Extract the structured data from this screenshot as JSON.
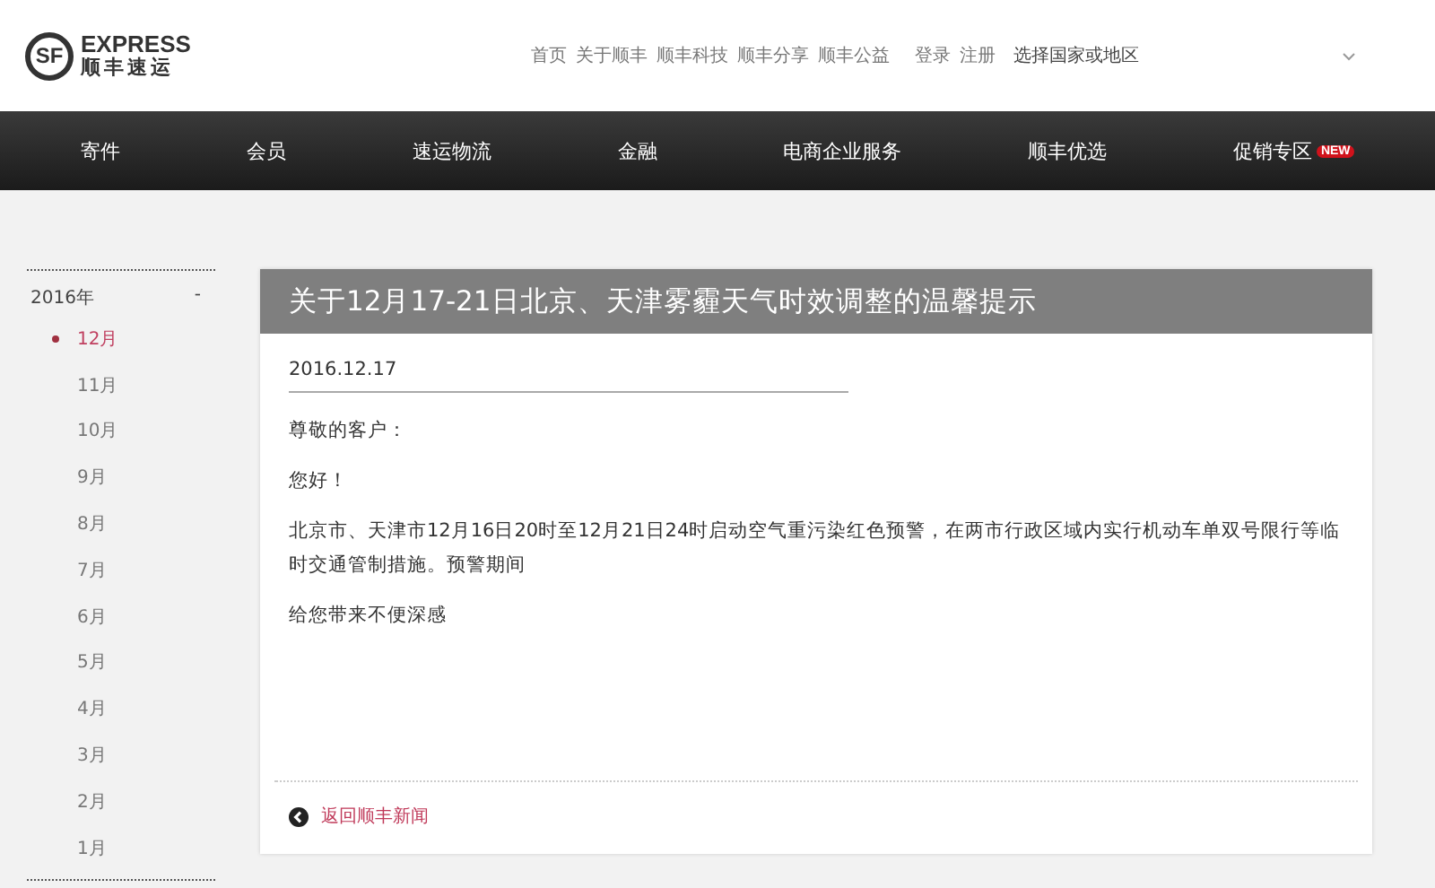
{
  "logo": {
    "mark": "SF",
    "brand": "EXPRESS",
    "name": "顺丰速运"
  },
  "top_links": [
    "首页",
    "关于顺丰",
    "顺丰科技",
    "顺丰分享",
    "顺丰公益"
  ],
  "account_links": [
    "登录",
    "注册"
  ],
  "region_select": {
    "label": "选择国家或地区"
  },
  "nav": [
    {
      "label": "寄件"
    },
    {
      "label": "会员"
    },
    {
      "label": "速运物流"
    },
    {
      "label": "金融"
    },
    {
      "label": "电商企业服务"
    },
    {
      "label": "顺丰优选"
    },
    {
      "label": "促销专区",
      "badge": "NEW"
    }
  ],
  "archive": {
    "year": "2016年",
    "toggle": "-",
    "months": [
      {
        "label": "12月",
        "selected": true
      },
      {
        "label": "11月",
        "selected": false
      },
      {
        "label": "10月",
        "selected": false
      },
      {
        "label": "9月",
        "selected": false
      },
      {
        "label": "8月",
        "selected": false
      },
      {
        "label": "7月",
        "selected": false
      },
      {
        "label": "6月",
        "selected": false
      },
      {
        "label": "5月",
        "selected": false
      },
      {
        "label": "4月",
        "selected": false
      },
      {
        "label": "3月",
        "selected": false
      },
      {
        "label": "2月",
        "selected": false
      },
      {
        "label": "1月",
        "selected": false
      }
    ]
  },
  "article": {
    "title": "关于12月17-21日北京、天津雾霾天气时效调整的温馨提示",
    "date": "2016.12.17",
    "paragraphs": [
      "尊敬的客户：",
      "您好！",
      "北京市、天津市12月16日20时至12月21日24时启动空气重污染红色预警，在两市行政区域内实行机动车单双号限行等临时交通管制措施。预警期间",
      "给您带来不便深感"
    ],
    "back_link": "返回顺丰新闻"
  }
}
